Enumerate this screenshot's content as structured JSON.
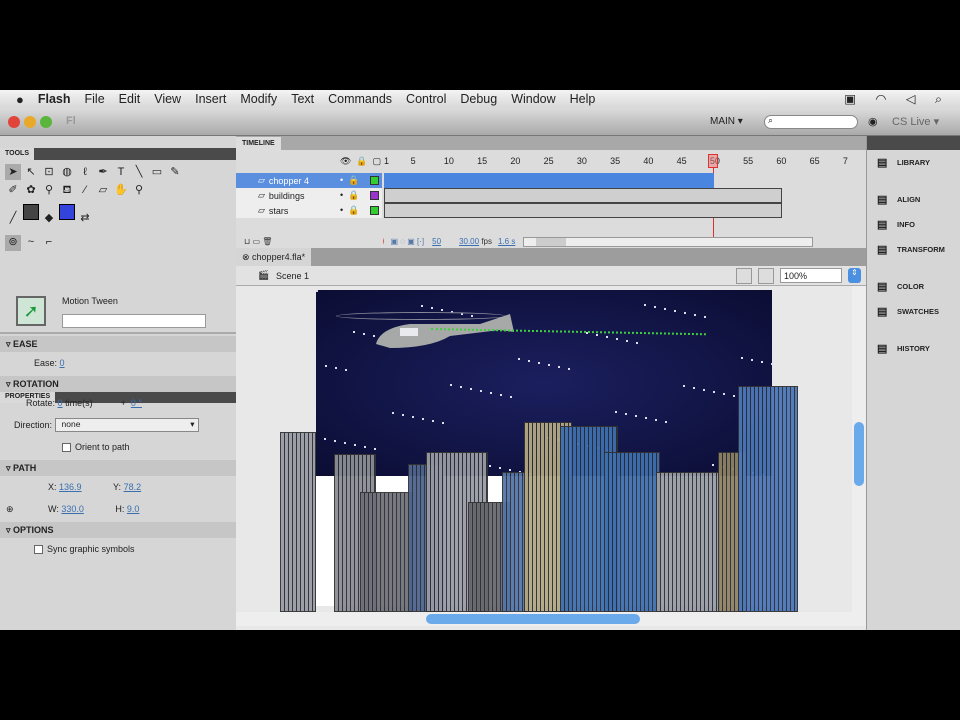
{
  "menubar": {
    "apple": "",
    "items": [
      "Flash",
      "File",
      "Edit",
      "View",
      "Insert",
      "Modify",
      "Text",
      "Commands",
      "Control",
      "Debug",
      "Window",
      "Help"
    ]
  },
  "titlebar": {
    "app_icon": "Fl",
    "workspace": "MAIN ▾",
    "search_placeholder": "",
    "cs_live": "CS Live ▾"
  },
  "tools": {
    "title": "TOOLS"
  },
  "properties": {
    "title": "PROPERTIES",
    "type": "Motion Tween",
    "name_value": "",
    "ease": {
      "section": "EASE",
      "label": "Ease:",
      "value": "0"
    },
    "rotation": {
      "section": "ROTATION",
      "rotate_label": "Rotate:",
      "times": "0",
      "times_unit": "time(s)",
      "plus": "+",
      "degrees": "0 °",
      "direction_label": "Direction:",
      "direction_value": "none",
      "orient": "Orient to path"
    },
    "path": {
      "section": "PATH",
      "x_label": "X:",
      "x": "136.9",
      "y_label": "Y:",
      "y": "78.2",
      "w_label": "W:",
      "w": "330.0",
      "h_label": "H:",
      "h": "9.0"
    },
    "options": {
      "section": "OPTIONS",
      "sync": "Sync graphic symbols"
    }
  },
  "timeline": {
    "title": "TIMELINE",
    "ticks": [
      "1",
      "5",
      "10",
      "15",
      "20",
      "25",
      "30",
      "35",
      "40",
      "45",
      "50",
      "55",
      "60",
      "65",
      "7"
    ],
    "current_frame": "50",
    "layers": [
      {
        "name": "chopper 4",
        "color": "#33cc33",
        "selected": true
      },
      {
        "name": "buildings",
        "color": "#9933cc",
        "selected": false
      },
      {
        "name": "stars",
        "color": "#33cc33",
        "selected": false
      }
    ],
    "status": {
      "frame": "50",
      "fps": "30.00",
      "fps_unit": "fps",
      "time": "1.6 s"
    }
  },
  "document": {
    "tab": "chopper4.fla*",
    "scene": "Scene 1",
    "zoom": "100%"
  },
  "right_panel": [
    {
      "icon": "library-icon",
      "label": "LIBRARY"
    },
    {
      "icon": "align-icon",
      "label": "ALIGN"
    },
    {
      "icon": "info-icon",
      "label": "INFO"
    },
    {
      "icon": "transform-icon",
      "label": "TRANSFORM"
    },
    {
      "icon": "color-icon",
      "label": "COLOR"
    },
    {
      "icon": "swatches-icon",
      "label": "SWATCHES"
    },
    {
      "icon": "history-icon",
      "label": "HISTORY"
    }
  ]
}
